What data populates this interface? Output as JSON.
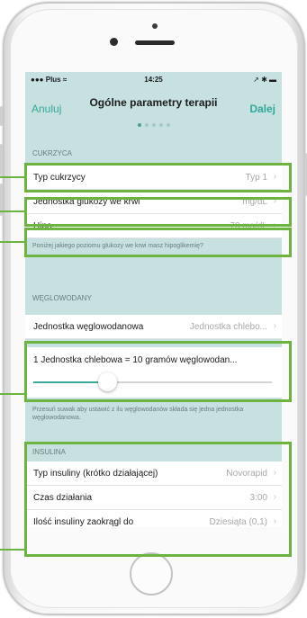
{
  "status_bar": {
    "carrier": "Plus",
    "time": "14:25",
    "right_icons": "↗ ✱ ▬"
  },
  "nav": {
    "cancel": "Anuluj",
    "title": "Ogólne parametry terapii",
    "next": "Dalej",
    "page_count": 5,
    "current_page": 1
  },
  "sections": {
    "diabetes": {
      "header": "CUKRZYCA",
      "rows": [
        {
          "label": "Typ cukrzycy",
          "value": "Typ 1"
        },
        {
          "label": "Jednostka glukozy we krwi",
          "value": "mg/dL"
        },
        {
          "label": "Hipo",
          "value": "70 mg/dL"
        }
      ],
      "note": "Poniżej jakiego poziomu glukozy we krwi masz hipoglikemię?"
    },
    "carbs": {
      "header": "WĘGLOWODANY",
      "rows": [
        {
          "label": "Jednostka węglowodanowa",
          "value": "Jednostka chlebo..."
        }
      ],
      "slider_label": "1 Jednostka chlebowa = 10 gramów węglowodan...",
      "slider_level": 0.31,
      "note": "Przesuń suwak aby ustawić z ilu węglowodanów składa się jedna jednostka węglowodanowa."
    },
    "insulin": {
      "header": "INSULINA",
      "rows": [
        {
          "label": "Typ insuliny (krótko działającej)",
          "value": "Novorapid"
        },
        {
          "label": "Czas działania",
          "value": "3:00"
        },
        {
          "label": "Ilość insuliny zaokrągl do",
          "value": "Dziesiąta (0,1)"
        }
      ]
    }
  },
  "chevron": "›",
  "colors": {
    "accent": "#34a89a",
    "highlight": "#6cb33f",
    "screen_bg": "#c6e1e0"
  },
  "icons": {
    "signal": "signal-icon",
    "wifi": "wifi-icon",
    "battery": "battery-icon"
  }
}
